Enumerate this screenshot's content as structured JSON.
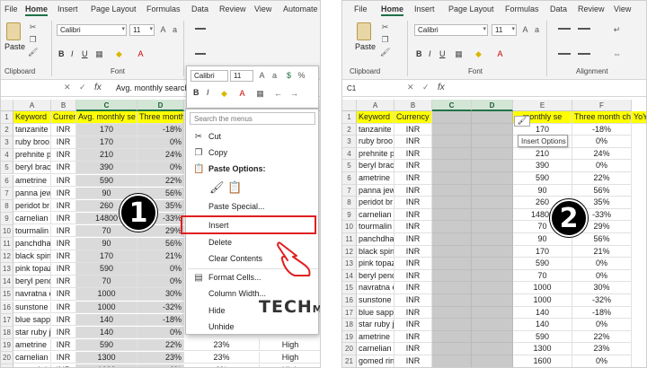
{
  "left": {
    "tabs": [
      "File",
      "Home",
      "Insert",
      "Page Layout",
      "Formulas",
      "Data",
      "Review",
      "View",
      "Automate"
    ],
    "ribbon": {
      "paste_label": "Paste",
      "clipboard_label": "Clipboard",
      "font_name": "Calibri",
      "font_size": "11",
      "font_label": "Font"
    },
    "name_box": "",
    "formula": "Avg. monthly search",
    "columns": [
      "A",
      "B",
      "C",
      "D",
      "E",
      "F"
    ],
    "header_row": [
      "Keyword",
      "Currency",
      "Avg. monthly se",
      "Three month"
    ],
    "rows": [
      {
        "r": "2",
        "keyword": "tanzanite",
        "currency": "INR",
        "avg": "170",
        "three": "-18%"
      },
      {
        "r": "3",
        "keyword": "ruby broo",
        "currency": "INR",
        "avg": "170",
        "three": "0%"
      },
      {
        "r": "4",
        "keyword": "prehnite p",
        "currency": "INR",
        "avg": "210",
        "three": "24%"
      },
      {
        "r": "5",
        "keyword": "beryl brac",
        "currency": "INR",
        "avg": "390",
        "three": "0%"
      },
      {
        "r": "6",
        "keyword": "ametrine",
        "currency": "INR",
        "avg": "590",
        "three": "22%"
      },
      {
        "r": "7",
        "keyword": "panna jew",
        "currency": "INR",
        "avg": "90",
        "three": "56%"
      },
      {
        "r": "8",
        "keyword": "peridot br",
        "currency": "INR",
        "avg": "260",
        "three": "35%"
      },
      {
        "r": "9",
        "keyword": "carnelian",
        "currency": "INR",
        "avg": "14800",
        "three": "-33%"
      },
      {
        "r": "10",
        "keyword": "tourmalin",
        "currency": "INR",
        "avg": "70",
        "three": "29%"
      },
      {
        "r": "11",
        "keyword": "panchdha",
        "currency": "INR",
        "avg": "90",
        "three": "56%"
      },
      {
        "r": "12",
        "keyword": "black spin",
        "currency": "INR",
        "avg": "170",
        "three": "21%"
      },
      {
        "r": "13",
        "keyword": "pink topaz",
        "currency": "INR",
        "avg": "590",
        "three": "0%"
      },
      {
        "r": "14",
        "keyword": "beryl pend",
        "currency": "INR",
        "avg": "70",
        "three": "0%"
      },
      {
        "r": "15",
        "keyword": "navratna e",
        "currency": "INR",
        "avg": "1000",
        "three": "30%"
      },
      {
        "r": "16",
        "keyword": "sunstone",
        "currency": "INR",
        "avg": "1000",
        "three": "-32%"
      },
      {
        "r": "17",
        "keyword": "blue sapp",
        "currency": "INR",
        "avg": "140",
        "three": "-18%"
      },
      {
        "r": "18",
        "keyword": "star ruby j",
        "currency": "INR",
        "avg": "140",
        "three": "0%"
      },
      {
        "r": "19",
        "keyword": "ametrine",
        "currency": "INR",
        "avg": "590",
        "three": "22%"
      },
      {
        "r": "20",
        "keyword": "carnelian",
        "currency": "INR",
        "avg": "1300",
        "three": "23%"
      },
      {
        "r": "21",
        "keyword": "gomed rin",
        "currency": "INR",
        "avg": "1600",
        "three": "0%"
      }
    ],
    "extra": [
      {
        "e": "23%",
        "f": "High"
      },
      {
        "e": "23%",
        "f": "High"
      },
      {
        "e": "0%",
        "f": "High"
      }
    ],
    "mini_toolbar": {
      "font_name": "Calibri",
      "font_size": "11"
    },
    "context_menu": {
      "search_placeholder": "Search the menus",
      "items": [
        "Cut",
        "Copy",
        "Paste Options:",
        "Paste Special...",
        "Insert",
        "Delete",
        "Clear Contents",
        "Format Cells...",
        "Column Width...",
        "Hide",
        "Unhide"
      ]
    },
    "badge": "1"
  },
  "right": {
    "tabs": [
      "File",
      "Home",
      "Insert",
      "Page Layout",
      "Formulas",
      "Data",
      "Review",
      "View"
    ],
    "ribbon": {
      "paste_label": "Paste",
      "clipboard_label": "Clipboard",
      "font_name": "Calibri",
      "font_size": "11",
      "font_label": "Font",
      "alignment_label": "Alignment"
    },
    "name_box": "C1",
    "columns": [
      "A",
      "B",
      "C",
      "D",
      "E",
      "F"
    ],
    "header_row": [
      "Keyword",
      "Currency",
      "",
      "",
      "monthly se",
      "Three month ch",
      "YoY c"
    ],
    "rows": [
      {
        "r": "2",
        "keyword": "tanzanite",
        "currency": "INR",
        "avg": "170",
        "three": "-18%"
      },
      {
        "r": "3",
        "keyword": "ruby broo",
        "currency": "INR",
        "avg": "170",
        "three": "0%"
      },
      {
        "r": "4",
        "keyword": "prehnite p",
        "currency": "INR",
        "avg": "210",
        "three": "24%"
      },
      {
        "r": "5",
        "keyword": "beryl brac",
        "currency": "INR",
        "avg": "390",
        "three": "0%"
      },
      {
        "r": "6",
        "keyword": "ametrine",
        "currency": "INR",
        "avg": "590",
        "three": "22%"
      },
      {
        "r": "7",
        "keyword": "panna jew",
        "currency": "INR",
        "avg": "90",
        "three": "56%"
      },
      {
        "r": "8",
        "keyword": "peridot br",
        "currency": "INR",
        "avg": "260",
        "three": "35%"
      },
      {
        "r": "9",
        "keyword": "carnelian",
        "currency": "INR",
        "avg": "14800",
        "three": "-33%"
      },
      {
        "r": "10",
        "keyword": "tourmalin",
        "currency": "INR",
        "avg": "70",
        "three": "29%"
      },
      {
        "r": "11",
        "keyword": "panchdha",
        "currency": "INR",
        "avg": "90",
        "three": "56%"
      },
      {
        "r": "12",
        "keyword": "black spin",
        "currency": "INR",
        "avg": "170",
        "three": "21%"
      },
      {
        "r": "13",
        "keyword": "pink topaz",
        "currency": "INR",
        "avg": "590",
        "three": "0%"
      },
      {
        "r": "14",
        "keyword": "beryl pend",
        "currency": "INR",
        "avg": "70",
        "three": "0%"
      },
      {
        "r": "15",
        "keyword": "navratna e",
        "currency": "INR",
        "avg": "1000",
        "three": "30%"
      },
      {
        "r": "16",
        "keyword": "sunstone",
        "currency": "INR",
        "avg": "1000",
        "three": "-32%"
      },
      {
        "r": "17",
        "keyword": "blue sapp",
        "currency": "INR",
        "avg": "140",
        "three": "-18%"
      },
      {
        "r": "18",
        "keyword": "star ruby j",
        "currency": "INR",
        "avg": "140",
        "three": "0%"
      },
      {
        "r": "19",
        "keyword": "ametrine",
        "currency": "INR",
        "avg": "590",
        "three": "22%"
      },
      {
        "r": "20",
        "keyword": "carnelian",
        "currency": "INR",
        "avg": "1300",
        "three": "23%"
      },
      {
        "r": "21",
        "keyword": "gomed rin",
        "currency": "INR",
        "avg": "1600",
        "three": "0%"
      }
    ],
    "tooltip": "Insert Options",
    "badge": "2"
  },
  "watermark": {
    "a": "TECH",
    "b": "MAJIN"
  },
  "colors": {
    "accent": "#217346",
    "header_fill": "#ffff00",
    "highlight": "#e02020",
    "selected_col": "#c9c9c9"
  }
}
